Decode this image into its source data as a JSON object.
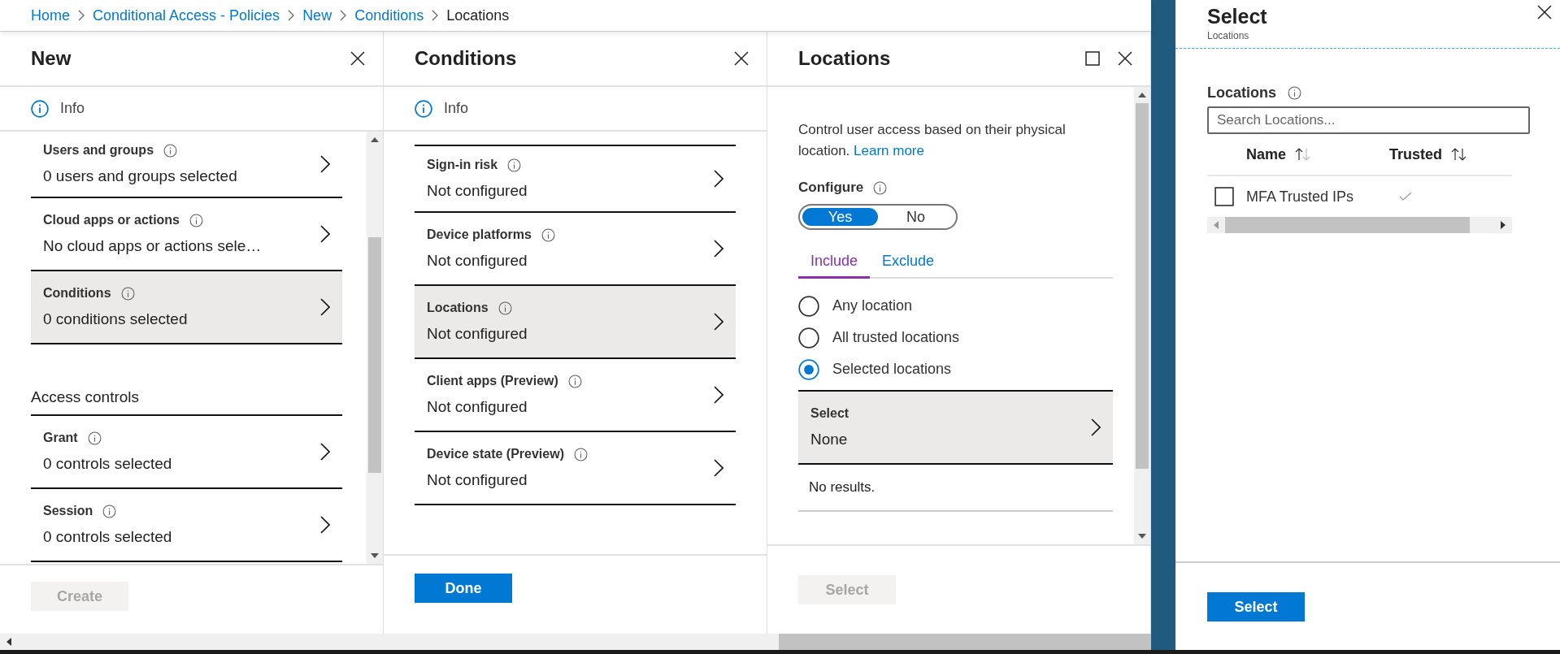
{
  "breadcrumb": [
    {
      "label": "Home",
      "current": false
    },
    {
      "label": "Conditional Access - Policies",
      "current": false
    },
    {
      "label": "New",
      "current": false
    },
    {
      "label": "Conditions",
      "current": false
    },
    {
      "label": "Locations",
      "current": true
    }
  ],
  "new_blade": {
    "title": "New",
    "info": "Info",
    "items": [
      {
        "title": "Users and groups",
        "value": "0 users and groups selected",
        "selected": false
      },
      {
        "title": "Cloud apps or actions",
        "value": "No cloud apps or actions sele…",
        "selected": false
      },
      {
        "title": "Conditions",
        "value": "0 conditions selected",
        "selected": true
      }
    ],
    "section_title": "Access controls",
    "access_items": [
      {
        "title": "Grant",
        "value": "0 controls selected",
        "selected": false
      },
      {
        "title": "Session",
        "value": "0 controls selected",
        "selected": false
      }
    ],
    "footer_button": {
      "label": "Create",
      "disabled": true
    }
  },
  "conditions_blade": {
    "title": "Conditions",
    "info": "Info",
    "items": [
      {
        "title": "Sign-in risk",
        "value": "Not configured",
        "selected": false
      },
      {
        "title": "Device platforms",
        "value": "Not configured",
        "selected": false
      },
      {
        "title": "Locations",
        "value": "Not configured",
        "selected": true
      },
      {
        "title": "Client apps (Preview)",
        "value": "Not configured",
        "selected": false
      },
      {
        "title": "Device state (Preview)",
        "value": "Not configured",
        "selected": false
      }
    ],
    "footer_button": {
      "label": "Done",
      "disabled": false
    }
  },
  "locations_blade": {
    "title": "Locations",
    "description": "Control user access based on their physical location.",
    "learn_more": "Learn more",
    "configure_label": "Configure",
    "toggle": [
      {
        "label": "Yes",
        "selected": true
      },
      {
        "label": "No",
        "selected": false
      }
    ],
    "tabs": [
      {
        "label": "Include",
        "selected": true
      },
      {
        "label": "Exclude",
        "selected": false
      }
    ],
    "options": [
      {
        "label": "Any location",
        "selected": false
      },
      {
        "label": "All trusted locations",
        "selected": false
      },
      {
        "label": "Selected locations",
        "selected": true
      }
    ],
    "select_row": {
      "title": "Select",
      "value": "None"
    },
    "no_results": "No results.",
    "footer_button": {
      "label": "Select",
      "disabled": true
    }
  },
  "select_blade": {
    "title": "Select",
    "subtitle": "Locations",
    "field_label": "Locations",
    "search": {
      "placeholder": "Search Locations..."
    },
    "columns": [
      "Name",
      "Trusted"
    ],
    "rows": [
      {
        "name": "MFA Trusted IPs",
        "checked": false,
        "trusted": true
      }
    ],
    "footer_button": {
      "label": "Select",
      "disabled": false
    }
  }
}
